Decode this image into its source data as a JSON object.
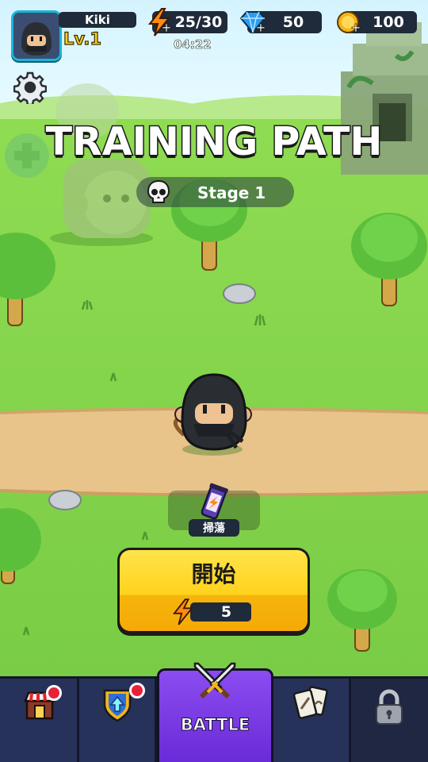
{
  "player": {
    "name": "Kiki",
    "level": "Lv.1"
  },
  "resources": {
    "energy": {
      "value": "25/30",
      "icon": "lightning-icon",
      "timer": "04:22"
    },
    "gems": {
      "value": "50",
      "icon": "gem-icon"
    },
    "coins": {
      "value": "100",
      "icon": "coin-icon"
    }
  },
  "screen": {
    "title": "TRAINING PATH",
    "stage_label": "Stage 1"
  },
  "actions": {
    "sweep_label": "掃蕩",
    "start_label": "開始",
    "start_cost": "5"
  },
  "nav": {
    "tabs": [
      {
        "name": "shop",
        "icon": "shop-icon",
        "badge": true
      },
      {
        "name": "upgrade",
        "icon": "upgrade-shield-icon",
        "badge": true
      },
      {
        "name": "battle",
        "label": "BATTLE",
        "icon": "crossed-swords-icon",
        "active": true
      },
      {
        "name": "cards",
        "icon": "cards-icon"
      },
      {
        "name": "locked",
        "icon": "lock-icon"
      }
    ]
  },
  "colors": {
    "grass": "#7fd24a",
    "path": "#e9c48a",
    "hud_pill": "#1f2a3a",
    "accent_yellow": "#ffd21c",
    "battle_purple": "#7a3ae6",
    "nav_bg": "#27325a",
    "badge_red": "#e8213a"
  }
}
